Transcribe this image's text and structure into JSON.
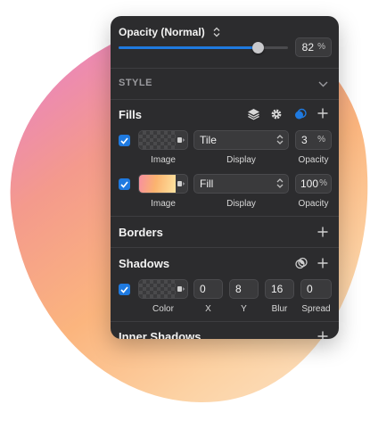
{
  "opacity": {
    "label": "Opacity (Normal)",
    "value": "82",
    "unit": "%",
    "slider_level": 0.82
  },
  "style": {
    "label": "STYLE"
  },
  "fills": {
    "label": "Fills",
    "items": [
      {
        "type_caption": "Image",
        "mode": "Tile",
        "display_caption": "Display",
        "opacity": "3",
        "opacity_unit": "%",
        "opacity_caption": "Opacity"
      },
      {
        "type_caption": "Image",
        "mode": "Fill",
        "display_caption": "Display",
        "opacity": "100",
        "opacity_unit": "%",
        "opacity_caption": "Opacity"
      }
    ]
  },
  "borders": {
    "label": "Borders"
  },
  "shadows": {
    "label": "Shadows",
    "color_caption": "Color",
    "fields": [
      {
        "value": "0",
        "caption": "X"
      },
      {
        "value": "8",
        "caption": "Y"
      },
      {
        "value": "16",
        "caption": "Blur"
      },
      {
        "value": "0",
        "caption": "Spread"
      }
    ]
  },
  "inner_shadows": {
    "label": "Inner Shadows"
  },
  "colors": {
    "accent": "#1f7ae0",
    "panel": "#2c2c2e",
    "field": "#3a3a3c"
  }
}
